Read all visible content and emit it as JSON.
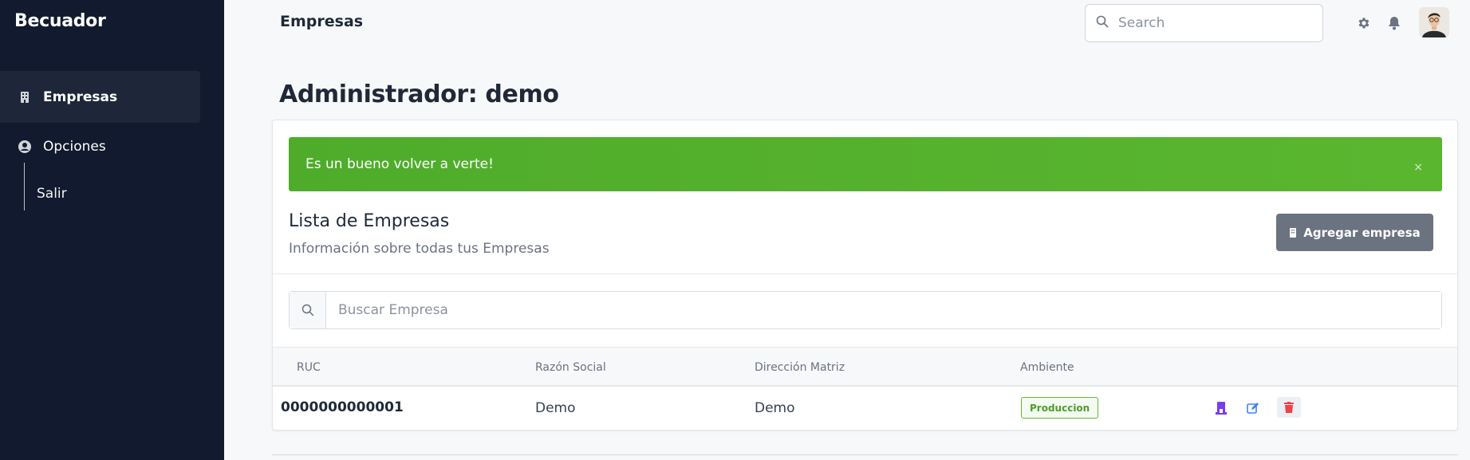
{
  "app": {
    "brand": "Becuador"
  },
  "sidebar": {
    "items": [
      {
        "label": "Empresas",
        "icon": "building-icon"
      },
      {
        "label": "Opciones",
        "icon": "user-circle-icon"
      }
    ],
    "sub_items": [
      {
        "label": "Salir"
      }
    ]
  },
  "header": {
    "title": "Empresas",
    "search_placeholder": "Search",
    "icons": [
      "gear-icon",
      "bell-icon",
      "avatar"
    ]
  },
  "page": {
    "heading": "Administrador: demo"
  },
  "alert": {
    "message": "Es un bueno volver a verte!",
    "close": "×",
    "color": "#52b12c"
  },
  "list": {
    "title": "Lista de Empresas",
    "subtitle": "Información sobre todas tus Empresas",
    "add_button": "Agregar empresa",
    "search_placeholder": "Buscar Empresa",
    "columns": [
      "RUC",
      "Razón Social",
      "Dirección Matriz",
      "Ambiente"
    ],
    "rows": [
      {
        "ruc": "0000000000001",
        "razon_social": "Demo",
        "direccion_matriz": "Demo",
        "ambiente": "Produccion",
        "actions": [
          "select-company-icon",
          "edit-icon",
          "delete-icon"
        ]
      }
    ]
  },
  "colors": {
    "sidebar_bg": "#111a2e",
    "alert_green": "#52b12c",
    "button_gray": "#6b7280",
    "badge_green": "#4c9d2a",
    "action_purple": "#7c3aed",
    "action_blue": "#3b82f6",
    "action_red": "#ef4444"
  }
}
